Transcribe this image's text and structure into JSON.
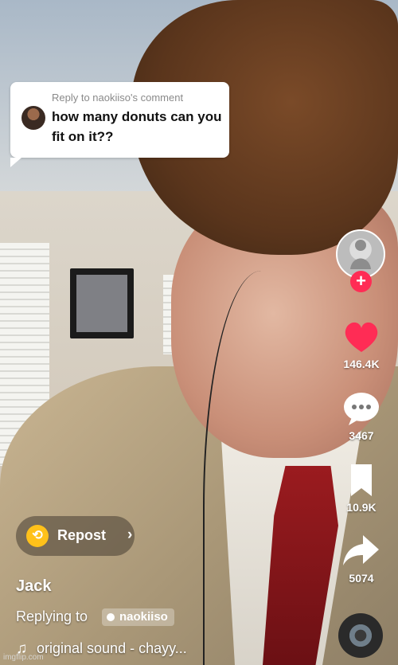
{
  "comment_bubble": {
    "title": "Reply to naokiiso's comment",
    "text": "how many donuts can you fit on it??"
  },
  "right_rail": {
    "likes": "146.4K",
    "comments": "3467",
    "saves": "10.9K",
    "shares": "5074"
  },
  "repost": {
    "label": "Repost"
  },
  "caption": {
    "username": "Jack",
    "replying_to": "Replying to",
    "replying_user": "naokiiso",
    "sound": "original sound - chayy..."
  },
  "watermark": "imgflip.com",
  "colors": {
    "like": "#ff2c55",
    "repost": "#ffc11a"
  }
}
